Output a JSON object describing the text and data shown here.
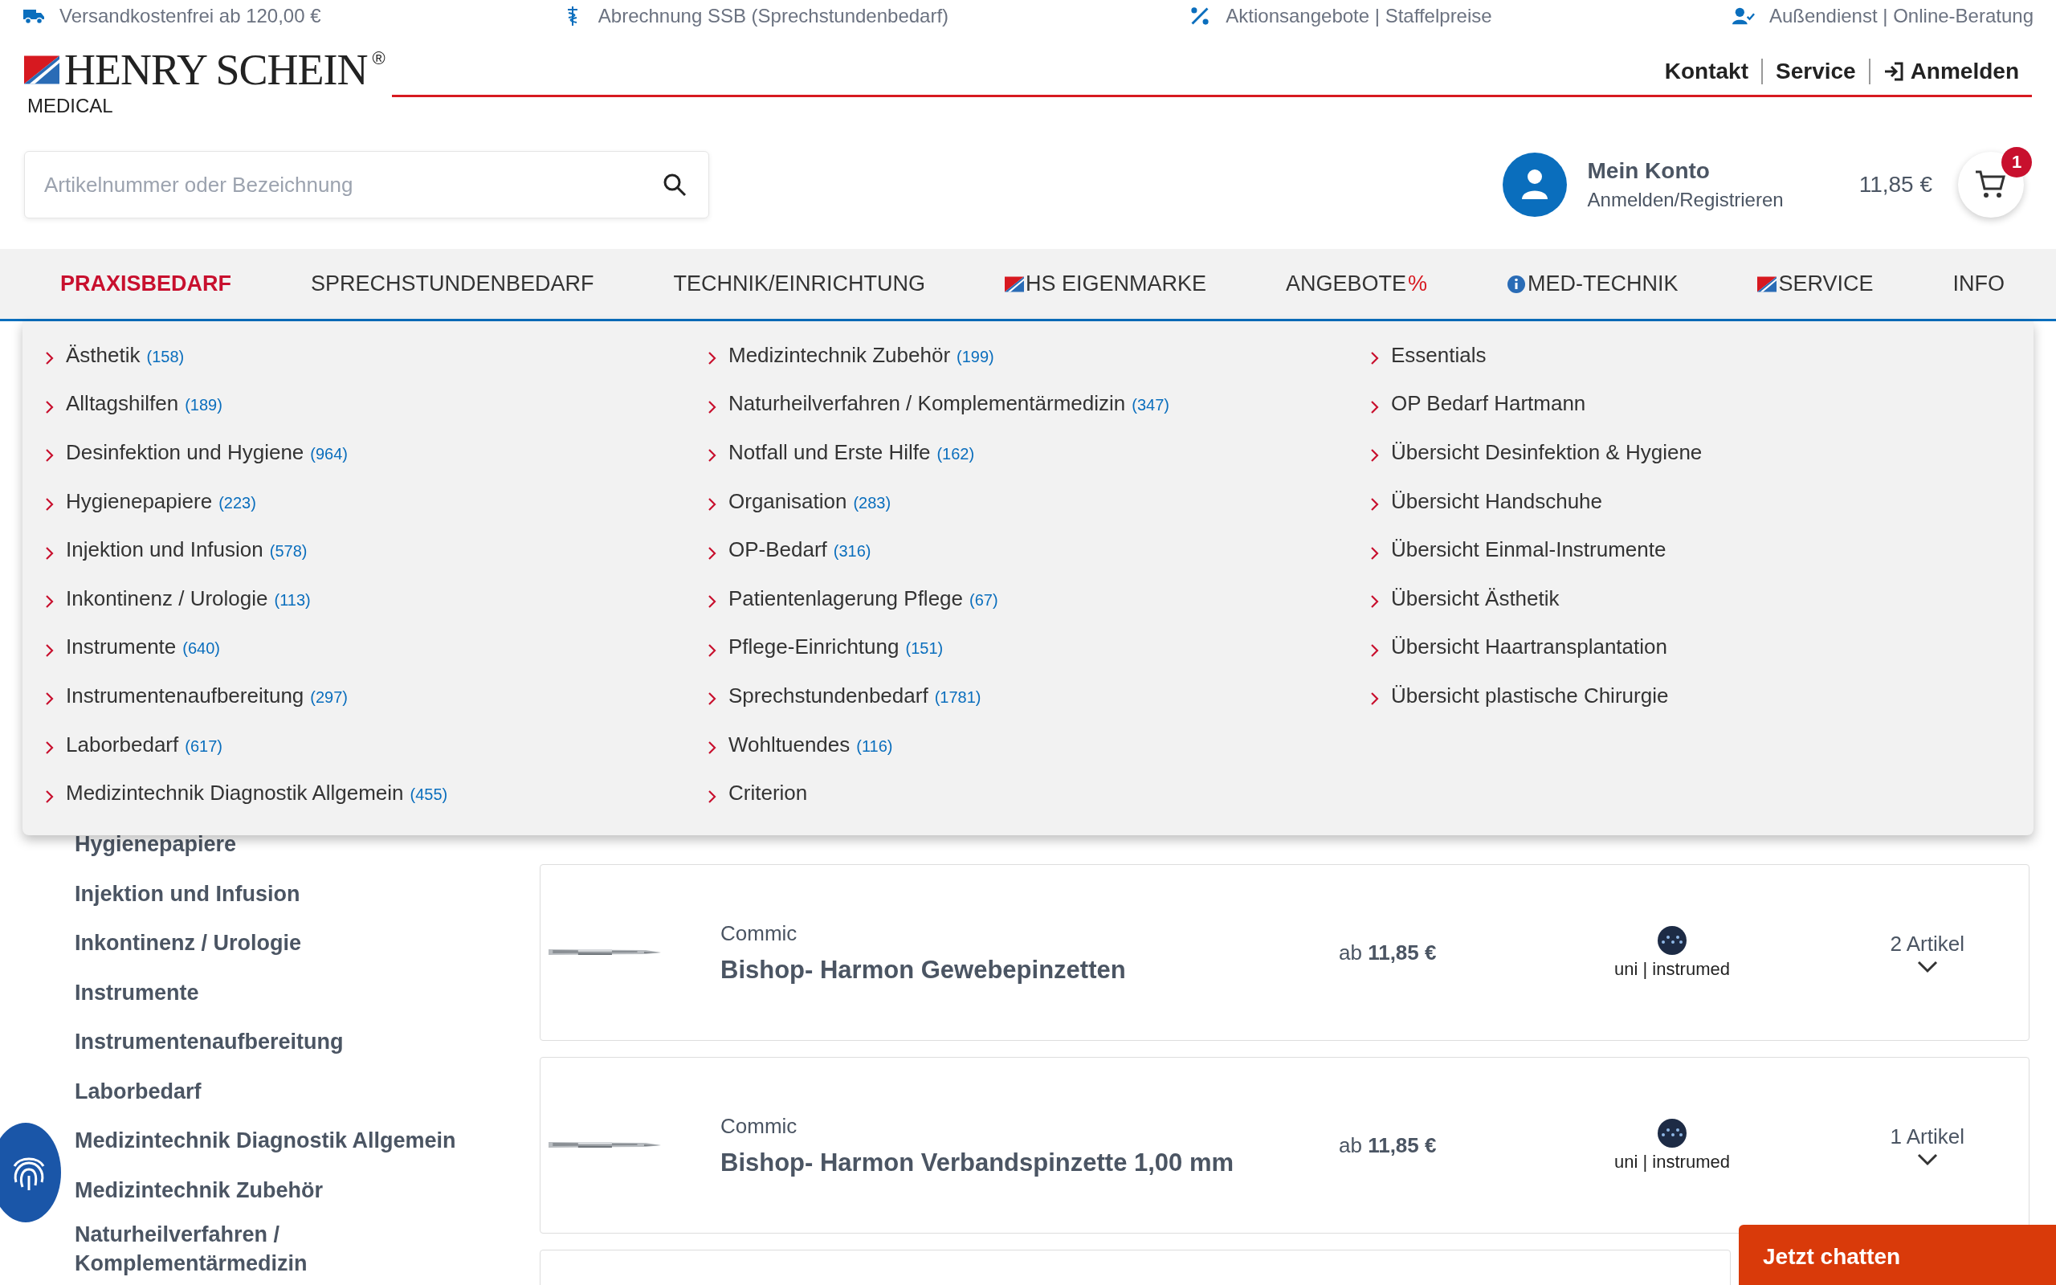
{
  "top_bar": [
    {
      "text": "Versandkostenfrei ab 120,00 €"
    },
    {
      "text": "Abrechnung SSB (Sprechstundenbedarf)"
    },
    {
      "text": "Aktionsangebote | Staffelpreise"
    },
    {
      "text": "Außendienst | Online-Beratung"
    }
  ],
  "header": {
    "logo": {
      "name": "HENRY SCHEIN",
      "mark": "®",
      "sub": "MEDICAL"
    },
    "links": [
      "Kontakt",
      "Service",
      "Anmelden"
    ],
    "search": {
      "placeholder": "Artikelnummer oder Bezeichnung"
    },
    "account": {
      "title": "Mein Konto",
      "subtitle": "Anmelden/Registrieren"
    },
    "cart": {
      "total": "11,85 €",
      "badge": "1"
    }
  },
  "nav": [
    {
      "label": "PRAXISBEDARF",
      "kind": "plain",
      "selected": true
    },
    {
      "label": "SPRECHSTUNDENBEDARF",
      "kind": "plain",
      "selected": false
    },
    {
      "label": "TECHNIK/EINRICHTUNG",
      "kind": "plain",
      "selected": false
    },
    {
      "label": "HS EIGENMARKE",
      "kind": "flag",
      "selected": false
    },
    {
      "label": "ANGEBOTE",
      "suffix": "%",
      "kind": "plain",
      "selected": false
    },
    {
      "label": "MED-TECHNIK",
      "kind": "info",
      "selected": false
    },
    {
      "label": "SERVICE",
      "kind": "flag",
      "selected": false
    },
    {
      "label": "INFO",
      "kind": "plain",
      "selected": false
    }
  ],
  "menu": {
    "columns": [
      [
        {
          "label": "Ästhetik",
          "count": "(158)"
        },
        {
          "label": "Alltagshilfen",
          "count": "(189)"
        },
        {
          "label": "Desinfektion und Hygiene",
          "count": "(964)"
        },
        {
          "label": "Hygienepapiere",
          "count": "(223)"
        },
        {
          "label": "Injektion und Infusion",
          "count": "(578)"
        },
        {
          "label": "Inkontinenz / Urologie",
          "count": "(113)"
        },
        {
          "label": "Instrumente",
          "count": "(640)"
        },
        {
          "label": "Instrumentenaufbereitung",
          "count": "(297)"
        },
        {
          "label": "Laborbedarf",
          "count": "(617)"
        },
        {
          "label": "Medizintechnik Diagnostik Allgemein",
          "count": "(455)"
        }
      ],
      [
        {
          "label": "Medizintechnik Zubehör",
          "count": "(199)"
        },
        {
          "label": "Naturheilverfahren / Komplementärmedizin",
          "count": "(347)"
        },
        {
          "label": "Notfall und Erste Hilfe",
          "count": "(162)"
        },
        {
          "label": "Organisation",
          "count": "(283)"
        },
        {
          "label": "OP-Bedarf",
          "count": "(316)"
        },
        {
          "label": "Patientenlagerung Pflege",
          "count": "(67)"
        },
        {
          "label": "Pflege-Einrichtung",
          "count": "(151)"
        },
        {
          "label": "Sprechstundenbedarf",
          "count": "(1781)"
        },
        {
          "label": "Wohltuendes",
          "count": "(116)"
        },
        {
          "label": "Criterion"
        }
      ],
      [
        {
          "label": "Essentials"
        },
        {
          "label": "OP Bedarf Hartmann"
        },
        {
          "label": "Übersicht Desinfektion & Hygiene"
        },
        {
          "label": "Übersicht Handschuhe"
        },
        {
          "label": "Übersicht Einmal-Instrumente"
        },
        {
          "label": "Übersicht Ästhetik"
        },
        {
          "label": "Übersicht Haartransplantation"
        },
        {
          "label": "Übersicht plastische Chirurgie"
        }
      ]
    ]
  },
  "sidebar": [
    "Hygienepapiere",
    "Injektion und Infusion",
    "Inkontinenz / Urologie",
    "Instrumente",
    "Instrumentenaufbereitung",
    "Laborbedarf",
    "Medizintechnik Diagnostik Allgemein",
    "Medizintechnik Zubehör",
    "Naturheilverfahren / Komplementärmedizin"
  ],
  "products": [
    {
      "brand": "Commic",
      "title": "Bishop- Harmon Gewebepinzetten",
      "price_prefix": "ab",
      "price": "11,85 €",
      "vendor": "uni | instrumed",
      "variants": "2 Artikel"
    },
    {
      "brand": "Commic",
      "title": "Bishop- Harmon Verbandspinzette 1,00 mm",
      "price_prefix": "ab",
      "price": "11,85 €",
      "vendor": "uni | instrumed",
      "variants": "1 Artikel"
    }
  ],
  "chat_button": "Jetzt chatten"
}
